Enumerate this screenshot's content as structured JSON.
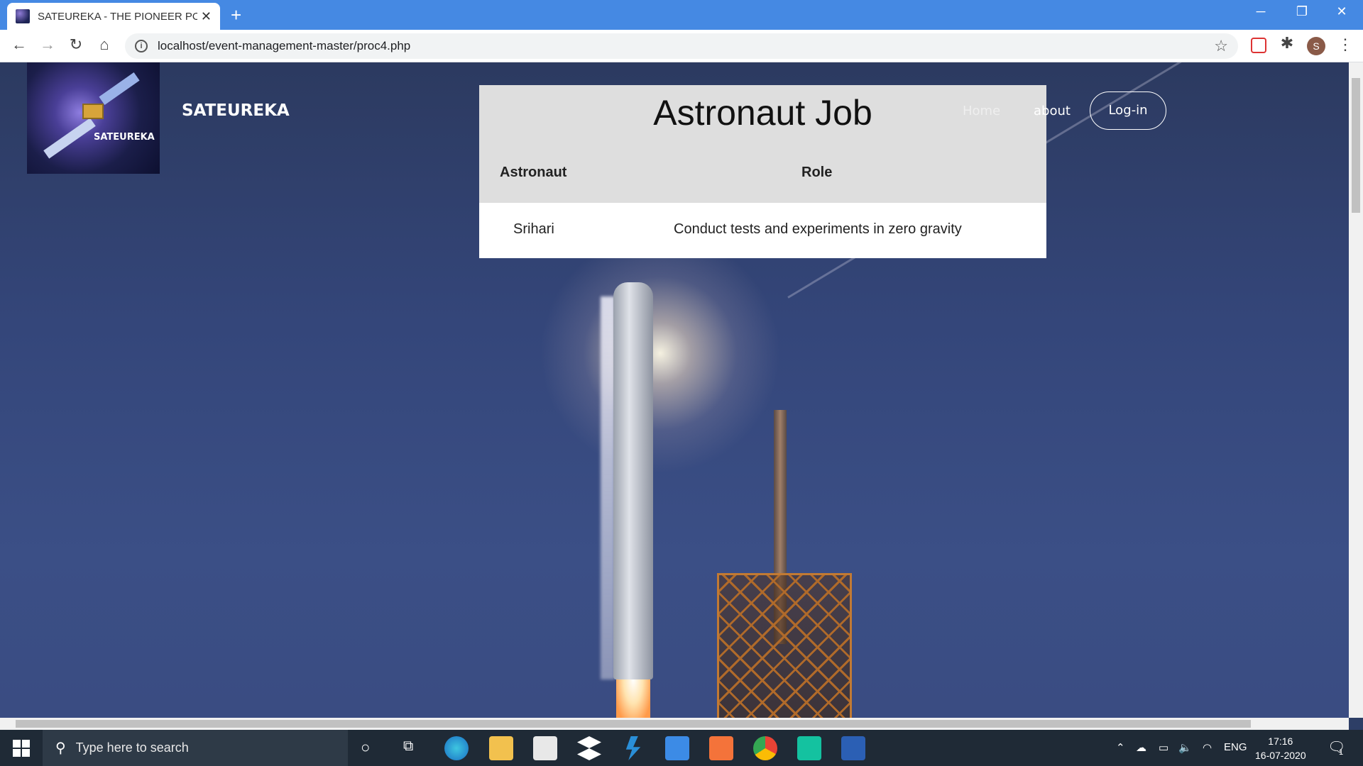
{
  "browser": {
    "tab_title": "SATEUREKA - THE PIONEER PORT",
    "tab_close": "✕",
    "new_tab": "+",
    "url": "localhost/event-management-master/proc4.php",
    "avatar_letter": "S"
  },
  "site": {
    "brand": "SATEUREKA",
    "logo_text": "SATEUREKA",
    "nav": {
      "home": "Home",
      "about": "about",
      "login": "Log-in"
    }
  },
  "card": {
    "title": "Astronaut Job",
    "headers": [
      "Astronaut",
      "Role"
    ],
    "rows": [
      {
        "astronaut": "Srihari",
        "role": "Conduct tests and experiments in zero gravity"
      }
    ]
  },
  "taskbar": {
    "search_placeholder": "Type here to search",
    "language": "ENG",
    "time": "17:16",
    "date": "16-07-2020",
    "notifications": "1"
  },
  "colors": {
    "titlebar": "#4589e3",
    "taskbar": "#1f2a36",
    "card_bg": "#dedede"
  }
}
